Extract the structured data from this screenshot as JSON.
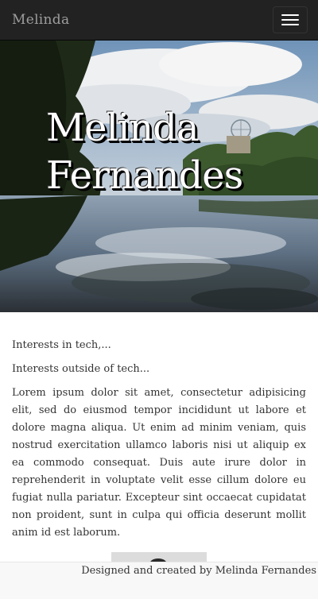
{
  "navbar": {
    "brand": "Melinda",
    "toggle_icon": "hamburger-menu-icon"
  },
  "hero": {
    "title_line1": "Melinda",
    "title_line2": "Fernandes",
    "image": "landscape photo of a lake with trees, cloudy sky and Ferris wheel in the distance"
  },
  "content": {
    "line1": "Interests in tech,...",
    "line2": "Interests outside of tech...",
    "lorem": "Lorem ipsum dolor sit amet, consectetur adipisicing elit, sed do eiusmod tempor incididunt ut labore et dolore magna aliqua. Ut enim ad minim veniam, quis nostrud exercitation ullamco laboris nisi ut aliquip ex ea commodo consequat. Duis aute irure dolor in reprehenderit in voluptate velit esse cillum dolore eu fugiat nulla pariatur. Excepteur sint occaecat cupidatat non proident, sunt in culpa qui officia deserunt mollit anim id est laborum."
  },
  "footer": {
    "text": "Designed and created by Melinda Fernandes"
  },
  "colors": {
    "navbar_bg": "#222222",
    "brand_text": "#9d9d9d",
    "footer_bg": "#f8f8f8",
    "body_text": "#333333"
  }
}
